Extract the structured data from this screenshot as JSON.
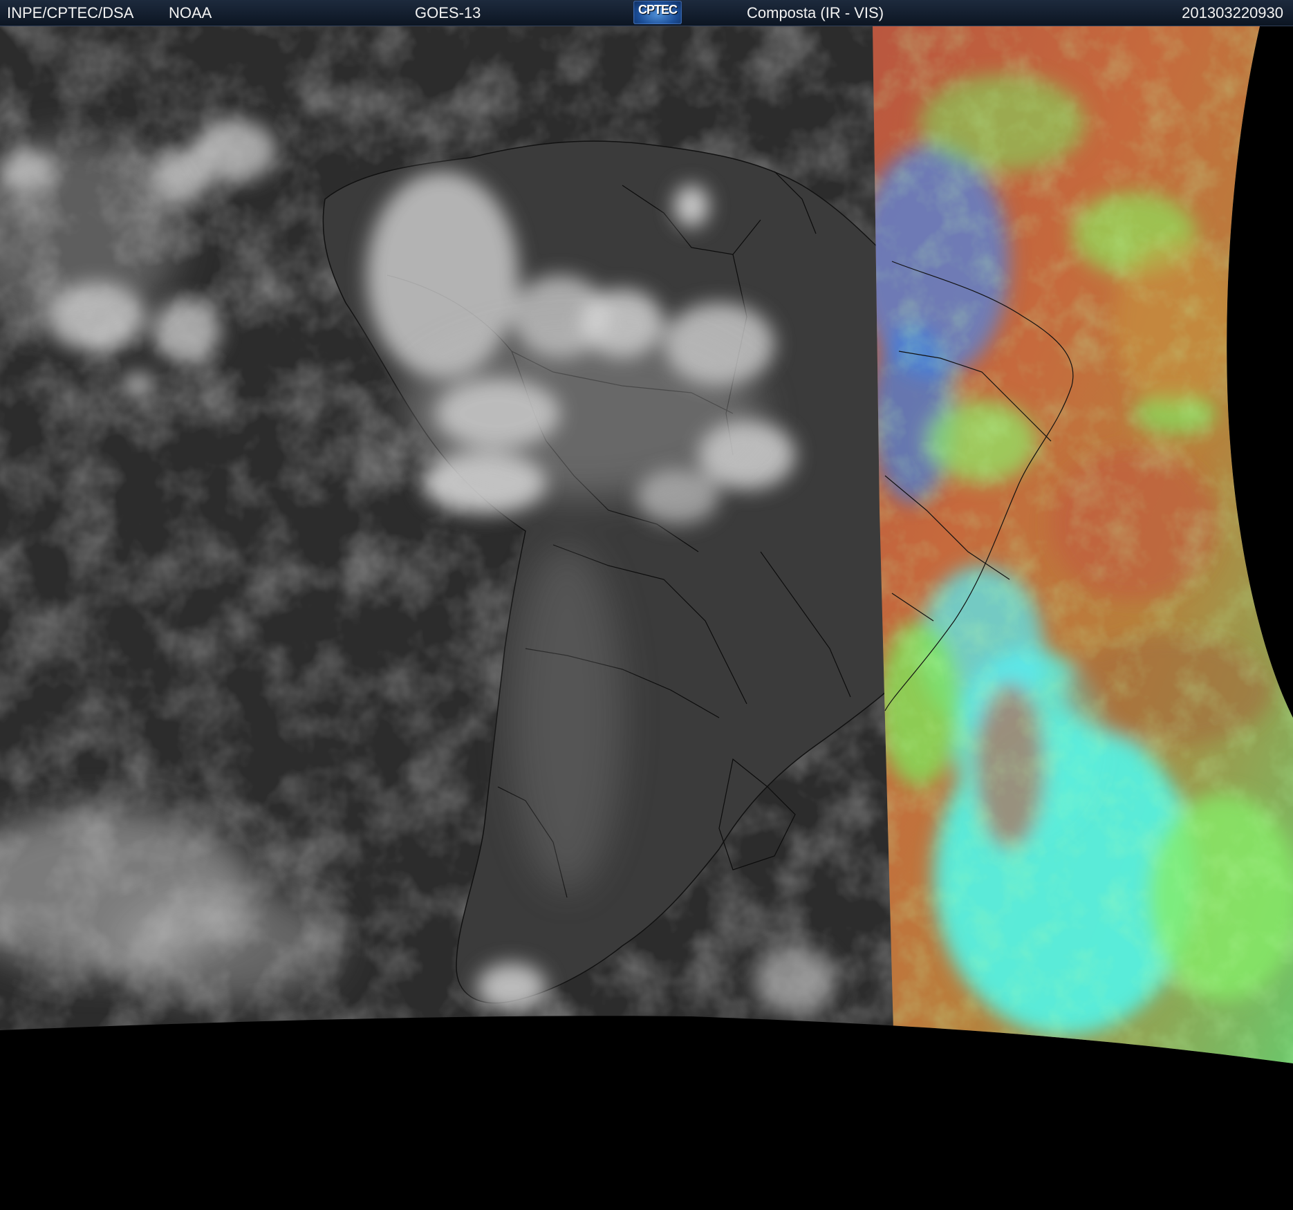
{
  "header": {
    "organization": "INPE/CPTEC/DSA",
    "agency": "NOAA",
    "satellite": "GOES-13",
    "logo_text": "CPTEC",
    "product": "Composta (IR - VIS)",
    "timestamp": "201303220930"
  },
  "colors": {
    "header_bg": "#101b2b",
    "background": "#000000",
    "ir_land": "#3a3a3a",
    "ir_ocean": "#2a2a2a",
    "clouds": "#d8d8d8",
    "vis_red": "#c0503a",
    "vis_orange": "#c8843a",
    "vis_green": "#7fe060",
    "vis_cyan": "#50f0e0",
    "vis_blue": "#4070e0"
  }
}
